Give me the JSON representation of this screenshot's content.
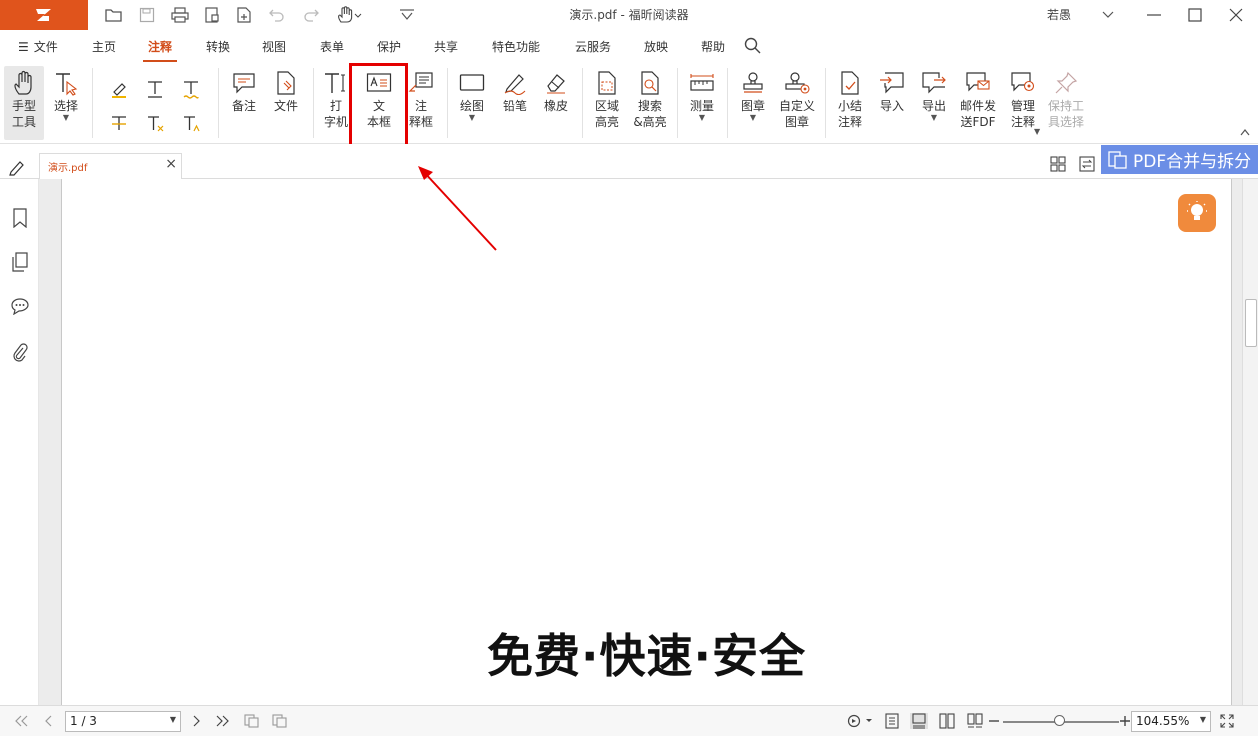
{
  "window": {
    "title": "演示.pdf - 福昕阅读器",
    "user": "若愚"
  },
  "menu": [
    {
      "label": "文件"
    },
    {
      "label": "主页"
    },
    {
      "label": "注释"
    },
    {
      "label": "转换"
    },
    {
      "label": "视图"
    },
    {
      "label": "表单"
    },
    {
      "label": "保护"
    },
    {
      "label": "共享"
    },
    {
      "label": "特色功能"
    },
    {
      "label": "云服务"
    },
    {
      "label": "放映"
    },
    {
      "label": "帮助"
    }
  ],
  "active_menu": "注释",
  "ribbon": {
    "hand": "手型\n工具",
    "select": "选择",
    "note": "备注",
    "file": "文件",
    "typewriter": "打\n字机",
    "textbox": "文\n本框",
    "callout": "注\n释框",
    "drawing": "绘图",
    "pencil": "铅笔",
    "eraser": "橡皮",
    "area_highlight": "区域\n高亮",
    "search_highlight": "搜索\n&高亮",
    "measure": "测量",
    "stamp": "图章",
    "custom_stamp": "自定义\n图章",
    "summary": "小结\n注释",
    "import": "导入",
    "export": "导出",
    "email_fdf": "邮件发\n送FDF",
    "manage": "管理\n注释",
    "keep_tool": "保持工\n具选择"
  },
  "tab": {
    "doc_name": "演示.pdf",
    "promo": "PDF合并与拆分"
  },
  "document": {
    "text": "免费·快速·安全"
  },
  "status": {
    "page": "1 / 3",
    "zoom": "104.55%"
  },
  "colors": {
    "brand": "#e0541c",
    "active_tab": "#d24d1a",
    "highlight_box": "#e40000",
    "promo": "#6b8ee6",
    "bulb": "#f08a3c"
  }
}
